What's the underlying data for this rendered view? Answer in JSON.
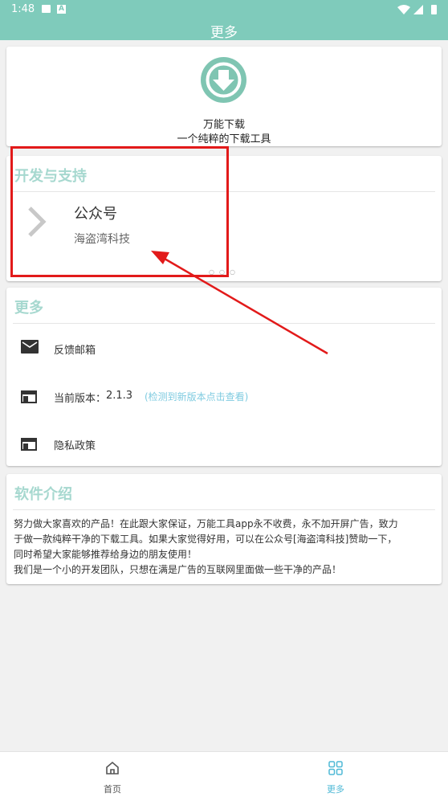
{
  "status_bar": {
    "time": "1:48",
    "a_badge": "A"
  },
  "app_bar": {
    "title": "更多"
  },
  "header_card": {
    "app_name": "万能下载",
    "tagline": "一个纯粹的下载工具"
  },
  "dev_section": {
    "title": "开发与支持",
    "account_title": "公众号",
    "account_name": "海盗湾科技"
  },
  "more_section": {
    "title": "更多",
    "feedback_label": "反馈邮箱",
    "version_label": "当前版本：",
    "version_value": "2.1.3",
    "update_link": "(检测到新版本点击查看)",
    "privacy_label": "隐私政策"
  },
  "intro_section": {
    "title": "软件介绍",
    "lines": [
      "努力做大家喜欢的产品！在此跟大家保证，万能工具app永不收费，永不加开屏广告，致力",
      "于做一款纯粹干净的下载工具。如果大家觉得好用，可以在公众号[海盗湾科技]赞助一下，",
      "同时希望大家能够推荐给身边的朋友使用！",
      "我们是一个小的开发团队，只想在满是广告的互联网里面做一些干净的产品！"
    ]
  },
  "bottom_nav": {
    "home_label": "首页",
    "more_label": "更多"
  },
  "colors": {
    "primary": "#7fcbbb",
    "section_title": "#a6d8cf",
    "link": "#7fcbe0",
    "annotation_red": "#e21a1a",
    "background": "#f1f1f1"
  }
}
